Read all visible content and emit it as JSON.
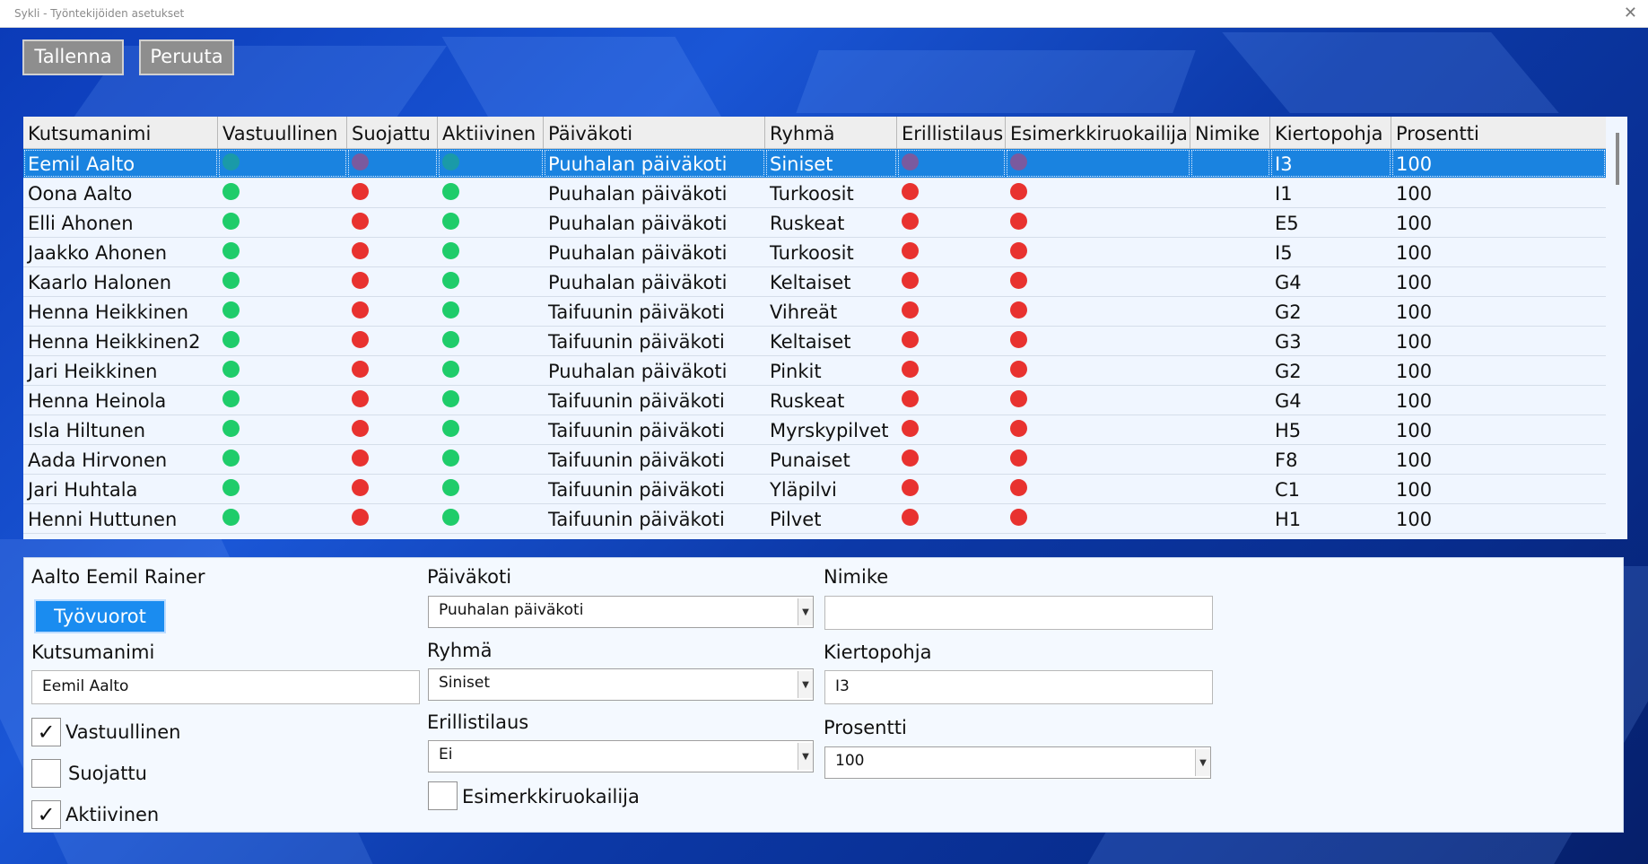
{
  "window": {
    "title": "Sykli - Työntekijöiden asetukset",
    "close_glyph": "✕"
  },
  "toolbar": {
    "save_label": "Tallenna",
    "cancel_label": "Peruuta"
  },
  "colors": {
    "green": "#1fcc6a",
    "red": "#e8322f",
    "teal_selected": "#1a9aa8",
    "purple_selected": "#7a5a9e",
    "selection": "#1a83e0"
  },
  "table": {
    "columns": [
      "Kutsumanimi",
      "Vastuullinen",
      "Suojattu",
      "Aktiivinen",
      "Päiväkoti",
      "Ryhmä",
      "Erillistilaus",
      "Esimerkkiruokailija",
      "Nimike",
      "Kiertopohja",
      "Prosentti"
    ],
    "rows": [
      {
        "name": "Eemil Aalto",
        "daycare": "Puuhalan päiväkoti",
        "group": "Siniset",
        "title": "",
        "rotation": "I3",
        "percent": "100"
      },
      {
        "name": "Oona Aalto",
        "daycare": "Puuhalan päiväkoti",
        "group": "Turkoosit",
        "title": "",
        "rotation": "I1",
        "percent": "100"
      },
      {
        "name": "Elli Ahonen",
        "daycare": "Puuhalan päiväkoti",
        "group": "Ruskeat",
        "title": "",
        "rotation": "E5",
        "percent": "100"
      },
      {
        "name": "Jaakko Ahonen",
        "daycare": "Puuhalan päiväkoti",
        "group": "Turkoosit",
        "title": "",
        "rotation": "I5",
        "percent": "100"
      },
      {
        "name": "Kaarlo Halonen",
        "daycare": "Puuhalan päiväkoti",
        "group": "Keltaiset",
        "title": "",
        "rotation": "G4",
        "percent": "100"
      },
      {
        "name": "Henna Heikkinen",
        "daycare": "Taifuunin päiväkoti",
        "group": "Vihreät",
        "title": "",
        "rotation": "G2",
        "percent": "100"
      },
      {
        "name": "Henna Heikkinen2",
        "daycare": "Taifuunin päiväkoti",
        "group": "Keltaiset",
        "title": "",
        "rotation": "G3",
        "percent": "100"
      },
      {
        "name": "Jari Heikkinen",
        "daycare": "Puuhalan päiväkoti",
        "group": "Pinkit",
        "title": "",
        "rotation": "G2",
        "percent": "100"
      },
      {
        "name": "Henna Heinola",
        "daycare": "Taifuunin päiväkoti",
        "group": "Ruskeat",
        "title": "",
        "rotation": "G4",
        "percent": "100"
      },
      {
        "name": "Isla Hiltunen",
        "daycare": "Taifuunin päiväkoti",
        "group": "Myrskypilvet",
        "title": "",
        "rotation": "H5",
        "percent": "100"
      },
      {
        "name": "Aada Hirvonen",
        "daycare": "Taifuunin päiväkoti",
        "group": "Punaiset",
        "title": "",
        "rotation": "F8",
        "percent": "100"
      },
      {
        "name": "Jari Huhtala",
        "daycare": "Taifuunin päiväkoti",
        "group": "Yläpilvi",
        "title": "",
        "rotation": "C1",
        "percent": "100"
      },
      {
        "name": "Henni Huttunen",
        "daycare": "Taifuunin päiväkoti",
        "group": "Pilvet",
        "title": "",
        "rotation": "H1",
        "percent": "100"
      }
    ]
  },
  "details": {
    "full_name": "Aalto Eemil Rainer",
    "shifts_button": "Työvuorot",
    "nickname_label": "Kutsumanimi",
    "nickname_value": "Eemil Aalto",
    "responsible_label": "Vastuullinen",
    "responsible_checked": true,
    "protected_label": "Suojattu",
    "protected_checked": false,
    "active_label": "Aktiivinen",
    "active_checked": true,
    "daycare_label": "Päiväkoti",
    "daycare_value": "Puuhalan päiväkoti",
    "group_label": "Ryhmä",
    "group_value": "Siniset",
    "special_order_label": "Erillistilaus",
    "special_order_value": "Ei",
    "example_eater_label": "Esimerkkiruokailija",
    "example_eater_checked": false,
    "title_label": "Nimike",
    "title_value": "",
    "rotation_label": "Kiertopohja",
    "rotation_value": "I3",
    "percent_label": "Prosentti",
    "percent_value": "100",
    "check_glyph": "✓",
    "dropdown_glyph": "▼"
  }
}
